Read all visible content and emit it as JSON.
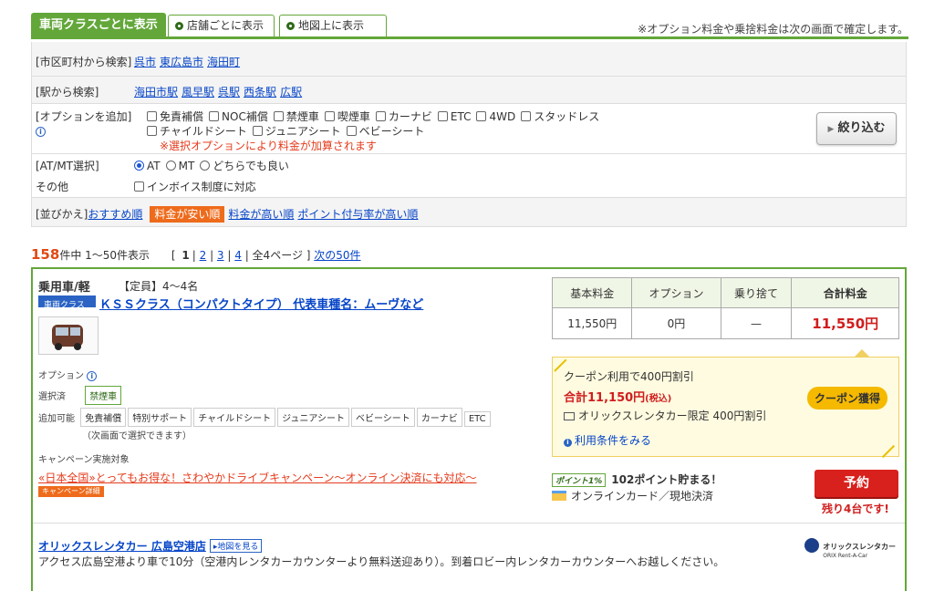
{
  "tabs": [
    {
      "label": "車両クラスごとに表示",
      "active": true
    },
    {
      "label": "店舗ごとに表示",
      "active": false
    },
    {
      "label": "地図上に表示",
      "active": false
    }
  ],
  "tab_note": "※オプション料金や乗捨料金は次の画面で確定します。",
  "filters": {
    "city_label": "[市区町村から検索]",
    "cities": [
      "呉市",
      "東広島市",
      "海田町"
    ],
    "station_label": "[駅から検索]",
    "stations": [
      "海田市駅",
      "風早駅",
      "呉駅",
      "西条駅",
      "広駅"
    ],
    "option_label": "[オプションを追加]",
    "options_row1": [
      "免責補償",
      "NOC補償",
      "禁煙車",
      "喫煙車",
      "カーナビ",
      "ETC",
      "4WD",
      "スタッドレス"
    ],
    "options_row2": [
      "チャイルドシート",
      "ジュニアシート",
      "ベビーシート"
    ],
    "option_warning": "※選択オプションにより料金が加算されます",
    "narrow_button": "絞り込む",
    "atmt_label": "[AT/MT選択]",
    "atmt_options": [
      "AT",
      "MT",
      "どちらでも良い"
    ],
    "other_label": "その他",
    "other_option": "インボイス制度に対応",
    "sort_label": "[並びかえ]",
    "sort_options": [
      "おすすめ順",
      "料金が安い順",
      "料金が高い順",
      "ポイント付与率が高い順"
    ]
  },
  "pager": {
    "count": "158",
    "count_suffix": "件中 1～50件表示",
    "open": "[",
    "pages": [
      "1",
      "2",
      "3",
      "4"
    ],
    "total": "| 全4ページ ]",
    "next": "次の50件"
  },
  "result": {
    "category": "乗用車/軽",
    "capacity": "【定員】4～4名",
    "class_badge": "車両クラス",
    "class_name": "ＫＳＳクラス（コンパクトタイプ） 代表車種名：ムーヴなど",
    "options_label": "オプション",
    "selected_label": "選択済",
    "selected_tags": [
      "禁煙車"
    ],
    "addable_label": "追加可能",
    "addable_tags": [
      "免責補償",
      "特別サポート",
      "チャイルドシート",
      "ジュニアシート",
      "ベビーシート",
      "カーナビ",
      "ETC"
    ],
    "addable_note": "（次画面で選択できます）",
    "campaign_label": "キャンペーン実施対象",
    "campaign_link": "«日本全国»とってもお得な！さわやかドライブキャンペーン～オンライン決済にも対応～",
    "campaign_badge": "キャンペーン詳細",
    "price_headers": [
      "基本料金",
      "オプション",
      "乗り捨て",
      "合計料金"
    ],
    "price_values": [
      "11,550円",
      "0円",
      "—",
      "11,550円"
    ],
    "coupon": {
      "line1": "クーポン利用で400円割引",
      "total": "合計11,150円",
      "tax": "(税込)",
      "line3": "オリックスレンタカー限定 400円割引",
      "terms": "利用条件をみる",
      "button": "クーポン獲得"
    },
    "point_badge": "ポイント1%",
    "points": "102ポイント貯まる！",
    "payment": "オンラインカード／現地決済",
    "reserve": "予約",
    "remaining": "残り4台です!"
  },
  "store": {
    "name": "オリックスレンタカー 広島空港店",
    "map_button": "地図を見る",
    "description": "アクセス広島空港より車で10分（空港内レンタカーカウンターより無料送迎あり）。到着ロビー内レンタカーカウンターへお越しください。",
    "logo_text": "オリックスレンタカー",
    "logo_sub": "ORIX Rent-A-Car"
  }
}
